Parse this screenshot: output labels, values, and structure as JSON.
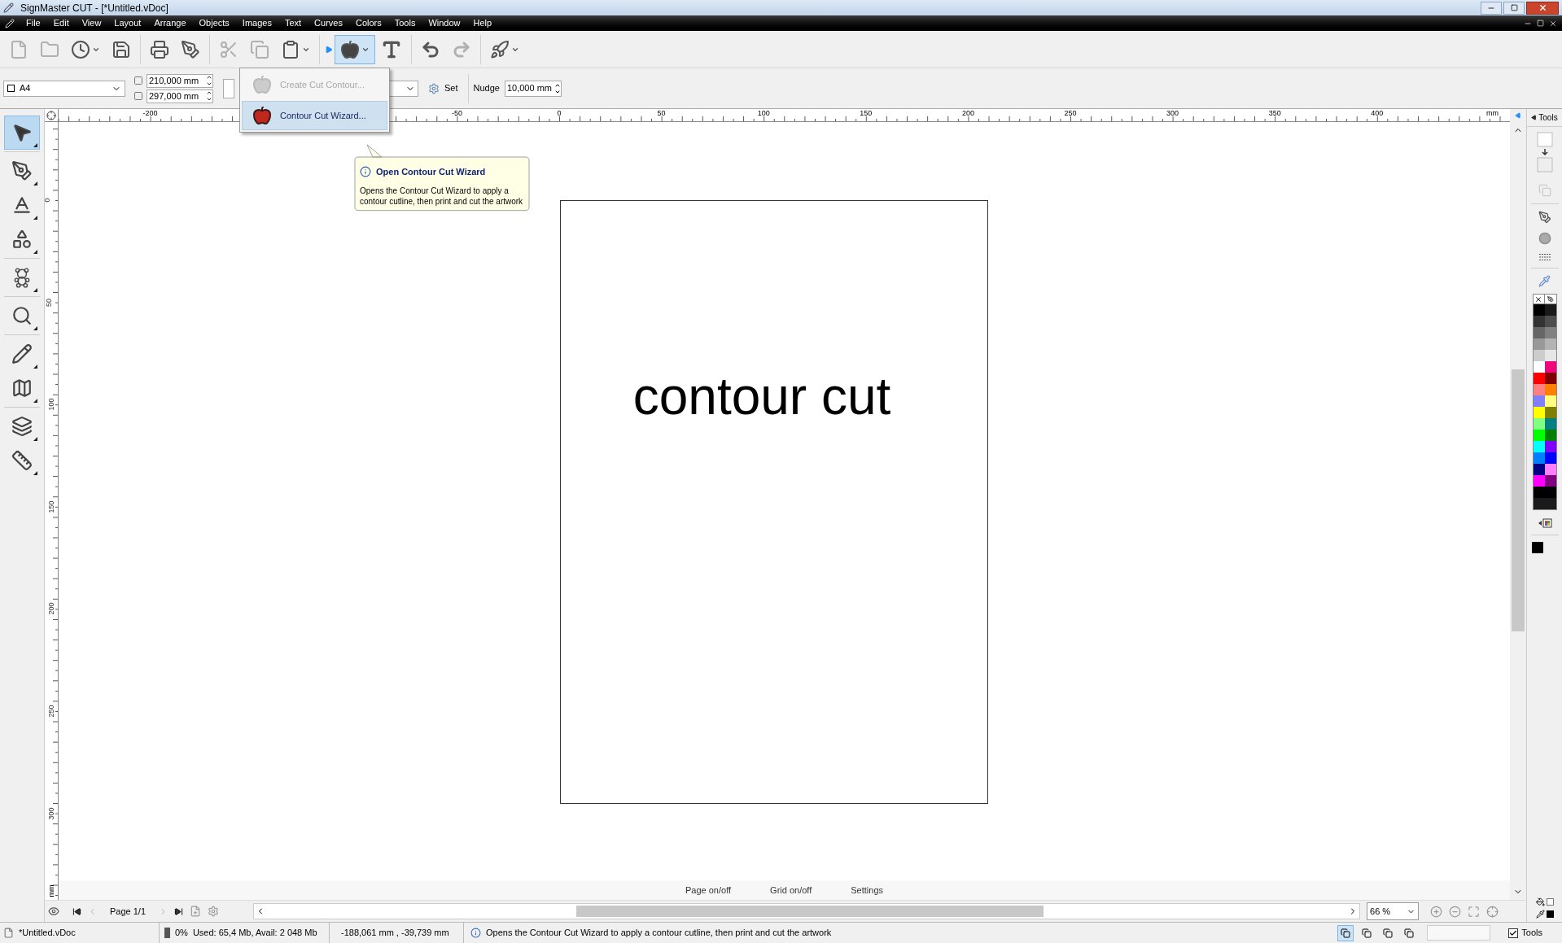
{
  "window": {
    "title": "SignMaster CUT - [*Untitled.vDoc]"
  },
  "menu": [
    "File",
    "Edit",
    "View",
    "Layout",
    "Arrange",
    "Objects",
    "Images",
    "Text",
    "Curves",
    "Colors",
    "Tools",
    "Window",
    "Help"
  ],
  "toolbar": {
    "contour_cut": {
      "selected": true
    }
  },
  "property_bar": {
    "page_size": "A4",
    "width": "210,000 mm",
    "height": "297,000 mm",
    "set_button": "Set",
    "nudge_label": "Nudge",
    "nudge_value": "10,000 mm"
  },
  "dropdown_menu": [
    {
      "label": "Create Cut Contour...",
      "disabled": true,
      "selected": false
    },
    {
      "label": "Contour Cut Wizard...",
      "disabled": false,
      "selected": true
    }
  ],
  "tooltip": {
    "title": "Open Contour Cut Wizard",
    "body": "Opens the Contour Cut Wizard to apply a contour cutline, then print and cut the artwork"
  },
  "toolbox": [
    {
      "selected": true
    },
    {
      "selected": false
    },
    {
      "selected": false
    },
    {
      "selected": false
    },
    {
      "selected": false
    },
    {
      "selected": false
    },
    {
      "selected": false
    },
    {
      "selected": false
    },
    {
      "selected": false
    },
    {
      "selected": false
    }
  ],
  "rulers": {
    "horizontal": [
      "-200",
      "-50",
      "0",
      "50",
      "100",
      "150",
      "200",
      "250",
      "300",
      "350",
      "400"
    ],
    "horizontal_unit": "mm",
    "vertical": [
      "0",
      "50",
      "100",
      "150",
      "200",
      "250",
      "300"
    ],
    "vertical_unit": "mm"
  },
  "canvas": {
    "text": "contour cut",
    "links": [
      "Page on/off",
      "Grid on/off",
      "Settings"
    ]
  },
  "page_nav": {
    "page": "Page 1/1",
    "zoom": "66 %"
  },
  "tools_panel": {
    "title": "Tools",
    "palette": [
      {
        "color": "#000000"
      },
      {
        "color": "#1a1a1a"
      },
      {
        "color": "#333333"
      },
      {
        "color": "#4d4d4d"
      },
      {
        "color": "#666666"
      },
      {
        "color": "#808080"
      },
      {
        "color": "#999999"
      },
      {
        "color": "#b3b3b3"
      },
      {
        "color": "#cccccc"
      },
      {
        "color": "#e6e6e6"
      },
      {
        "color": "#ffffff"
      },
      {
        "color": "#f0067a"
      },
      {
        "color": "#ff0000"
      },
      {
        "color": "#800000"
      },
      {
        "color": "#ff8080"
      },
      {
        "color": "#ff8000"
      },
      {
        "color": "#8080ff"
      },
      {
        "color": "#ffff80"
      },
      {
        "color": "#ffff00"
      },
      {
        "color": "#808000"
      },
      {
        "color": "#80ff80"
      },
      {
        "color": "#008080"
      },
      {
        "color": "#00ff00"
      },
      {
        "color": "#008000"
      },
      {
        "color": "#00ffff"
      },
      {
        "color": "#8000ff"
      },
      {
        "color": "#0080ff"
      },
      {
        "color": "#0000ff"
      },
      {
        "color": "#000080"
      },
      {
        "color": "#ff80ff"
      },
      {
        "color": "#ff00ff"
      },
      {
        "color": "#800080"
      },
      {
        "color": "#000001"
      },
      {
        "color": "#000002"
      },
      {
        "color": "#1a1a1b"
      },
      {
        "color": "#1a1a1c"
      }
    ]
  },
  "status_bar": {
    "file": "*Untitled.vDoc",
    "progress": "0%",
    "memory": "Used: 65,4 Mb, Avail: 2 048 Mb",
    "coordinates": "-188,061 mm , -39,739 mm",
    "message": "Opens the Contour Cut Wizard to apply a contour cutline, then print and cut the artwork",
    "view_modes": [
      {
        "selected": true
      },
      {
        "selected": false
      },
      {
        "selected": false
      },
      {
        "selected": false
      }
    ],
    "tools_checkbox": {
      "label": "Tools",
      "checked": true
    }
  }
}
